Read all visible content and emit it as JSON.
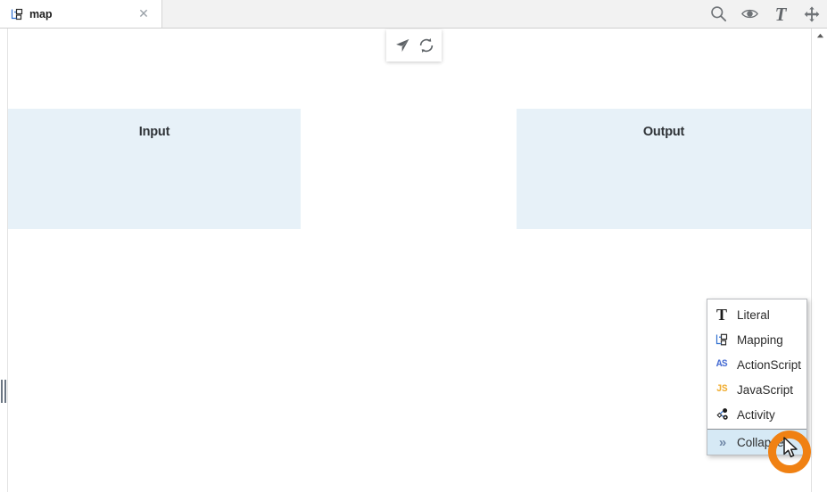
{
  "window": {
    "tab": {
      "label": "map",
      "icon": "mapping-icon",
      "close_icon": "close-icon"
    },
    "toolbar": {
      "icons": [
        {
          "name": "search-icon",
          "title": "Search"
        },
        {
          "name": "eye-icon",
          "title": "Preview"
        },
        {
          "name": "text-icon",
          "title": "Text",
          "glyph": "T"
        },
        {
          "name": "move-icon",
          "title": "Pan"
        }
      ]
    }
  },
  "canvas": {
    "float_toolbar": {
      "icons": [
        {
          "name": "send-icon",
          "title": "Run"
        },
        {
          "name": "refresh-icon",
          "title": "Refresh"
        }
      ]
    },
    "regions": [
      {
        "name": "input-region",
        "title": "Input",
        "color": "#e7f1f8"
      },
      {
        "name": "output-region",
        "title": "Output",
        "color": "#e7f1f8"
      }
    ],
    "splitters": [
      {
        "name": "left-splitter"
      },
      {
        "name": "right-splitter"
      }
    ]
  },
  "scrollbar": {
    "up_arrow": "scroll-up-arrow"
  },
  "context_menu": {
    "items": [
      {
        "label": "Literal",
        "icon": "literal-icon",
        "selected": false
      },
      {
        "label": "Mapping",
        "icon": "mapping-icon",
        "selected": false
      },
      {
        "label": "ActionScript",
        "icon": "actionscript-icon",
        "badge": "AS",
        "selected": false
      },
      {
        "label": "JavaScript",
        "icon": "javascript-icon",
        "badge": "JS",
        "selected": false
      },
      {
        "label": "Activity",
        "icon": "activity-icon",
        "selected": false
      },
      {
        "label": "Collapse",
        "icon": "collapse-icon",
        "glyph": "»",
        "selected": true
      }
    ],
    "highlight_color": "#d6e9f5"
  },
  "pointer": {
    "click_ring_color": "#f08113",
    "cursor": "arrow-cursor"
  }
}
